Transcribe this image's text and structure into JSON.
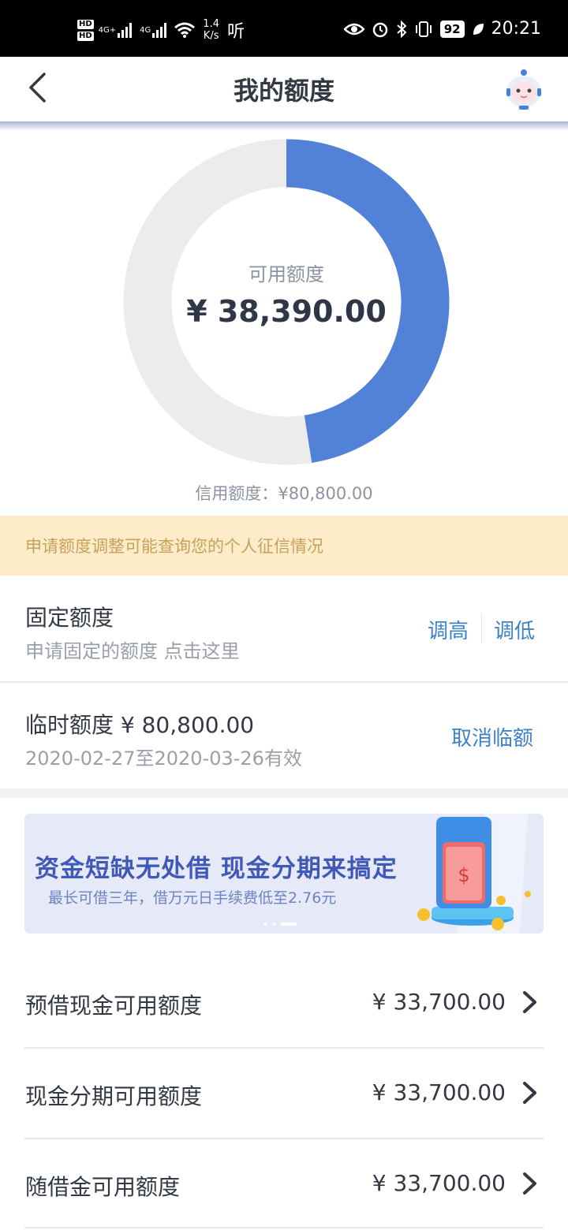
{
  "status_bar": {
    "hd1": "HD",
    "hd2": "HD",
    "net1": "4G+",
    "net2": "4G",
    "speed_value": "1.4",
    "speed_unit": "K/s",
    "ting": "听",
    "battery": "92",
    "time": "20:21"
  },
  "header": {
    "title": "我的额度"
  },
  "donut": {
    "label": "可用额度",
    "amount": "¥ 38,390.00",
    "available_fraction": 0.475,
    "colors": {
      "available": "#5282d8",
      "used": "#ececec"
    }
  },
  "credit_limit": "信用额度：¥80,800.00",
  "notice": "申请额度调整可能查询您的个人征信情况",
  "fixed_limit": {
    "title": "固定额度",
    "subtitle": "申请固定的额度 点击这里",
    "raise": "调高",
    "lower": "调低"
  },
  "temp_limit": {
    "title": "临时额度 ¥ 80,800.00",
    "validity": "2020-02-27至2020-03-26有效",
    "cancel": "取消临额"
  },
  "banner": {
    "headline": "资金短缺无处借 现金分期来搞定",
    "sub": "最长可借三年，借万元日手续费低至2.76元",
    "slides": 3,
    "active_slide": 3
  },
  "quota_list": [
    {
      "label": "预借现金可用额度",
      "value": "¥ 33,700.00"
    },
    {
      "label": "现金分期可用额度",
      "value": "¥ 33,700.00"
    },
    {
      "label": "随借金可用额度",
      "value": "¥ 33,700.00"
    }
  ],
  "accent_color": "#3e82c7"
}
